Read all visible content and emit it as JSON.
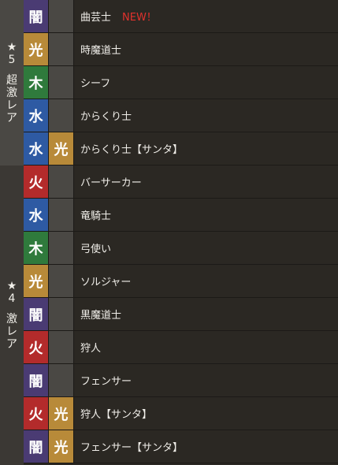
{
  "ranks": {
    "r5": {
      "star": "★",
      "num": "5",
      "l1": "超",
      "l2": "激",
      "l3": "レ",
      "l4": "ア"
    },
    "r4": {
      "star": "★",
      "num": "4",
      "l1": "激",
      "l2": "レ",
      "l3": "ア"
    }
  },
  "colors": {
    "dark": "#4a3b73",
    "light": "#b88a39",
    "wood": "#2f7a3c",
    "water": "#2e5aa3",
    "fire": "#b32b2b"
  },
  "rows": [
    {
      "a1": "闇",
      "a2": "",
      "name": "曲芸士",
      "badge": "NEW！"
    },
    {
      "a1": "光",
      "a2": "",
      "name": "時魔道士"
    },
    {
      "a1": "木",
      "a2": "",
      "name": "シーフ"
    },
    {
      "a1": "水",
      "a2": "",
      "name": "からくり士"
    },
    {
      "a1": "水",
      "a2": "光",
      "name": "からくり士【サンタ】"
    },
    {
      "a1": "火",
      "a2": "",
      "name": "バーサーカー"
    },
    {
      "a1": "水",
      "a2": "",
      "name": "竜騎士"
    },
    {
      "a1": "木",
      "a2": "",
      "name": "弓使い"
    },
    {
      "a1": "光",
      "a2": "",
      "name": "ソルジャー"
    },
    {
      "a1": "闇",
      "a2": "",
      "name": "黒魔道士"
    },
    {
      "a1": "火",
      "a2": "",
      "name": "狩人"
    },
    {
      "a1": "闇",
      "a2": "",
      "name": "フェンサー"
    },
    {
      "a1": "火",
      "a2": "光",
      "name": "狩人【サンタ】"
    },
    {
      "a1": "闇",
      "a2": "光",
      "name": "フェンサー【サンタ】"
    }
  ]
}
